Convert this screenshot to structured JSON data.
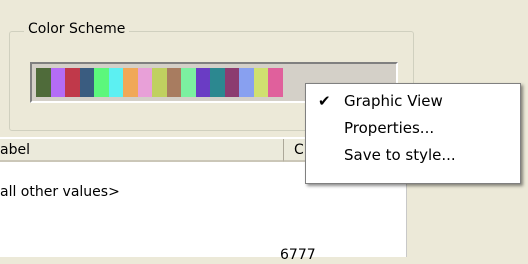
{
  "color_scheme": {
    "title": "Color Scheme",
    "swatches": [
      "#4f6b3a",
      "#b46cf6",
      "#c0394a",
      "#3a5c80",
      "#5cf77c",
      "#5cf0f2",
      "#f0a858",
      "#e8a0d8",
      "#c0d060",
      "#a87c60",
      "#7cf0a0",
      "#6a3cc4",
      "#2c8890",
      "#8c3c70",
      "#88a0f0",
      "#d0e070",
      "#e0609c"
    ]
  },
  "list": {
    "columns": [
      "abel",
      "C"
    ],
    "rows": [
      "all other values>"
    ],
    "bottom_value": "6777"
  },
  "context_menu": {
    "items": [
      {
        "label": "Graphic View",
        "checked": true
      },
      {
        "label": "Properties..."
      },
      {
        "label": "Save to style..."
      }
    ]
  }
}
